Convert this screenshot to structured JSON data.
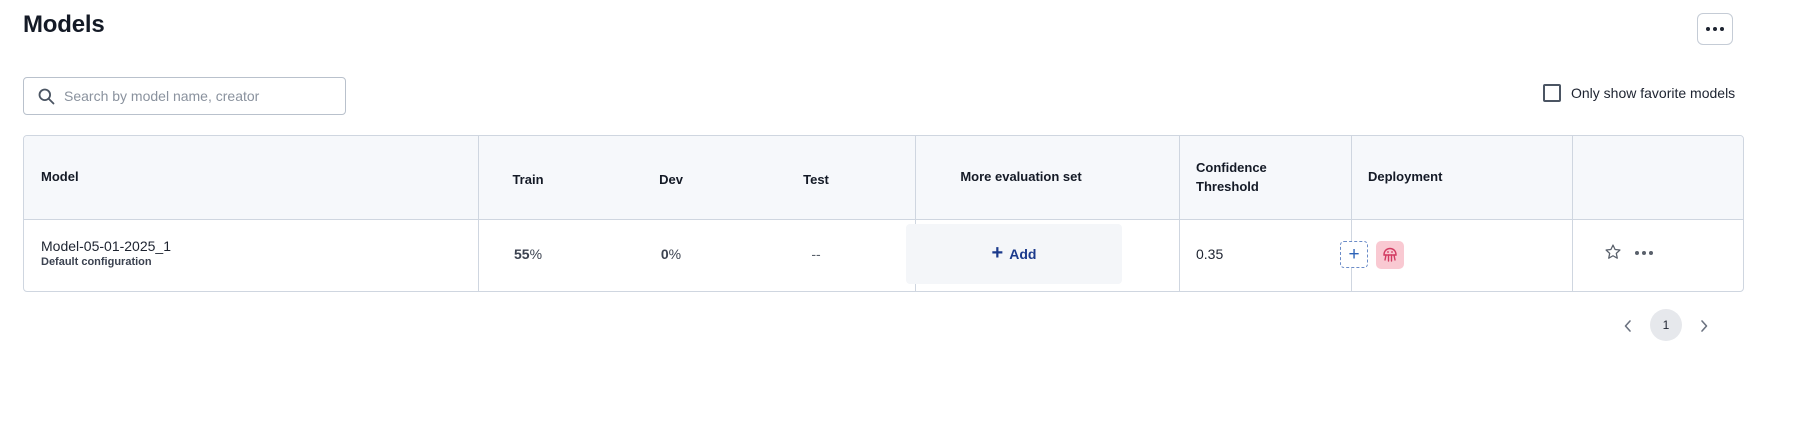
{
  "header": {
    "title": "Models"
  },
  "search": {
    "placeholder": "Search by model name, creator"
  },
  "filters": {
    "favorites_label": "Only show favorite models",
    "favorites_checked": false
  },
  "table": {
    "columns": {
      "model": "Model",
      "train": "Train",
      "dev": "Dev",
      "test": "Test",
      "more_eval": "More evaluation set",
      "confidence_line1": "Confidence",
      "confidence_line2": "Threshold",
      "deployment": "Deployment"
    },
    "rows": [
      {
        "model_name": "Model-05-01-2025_1",
        "configuration": "Default configuration",
        "train_value": "55",
        "train_unit": "%",
        "dev_value": "0",
        "dev_unit": "%",
        "test": "--",
        "add_label": "Add",
        "confidence_threshold": "0.35",
        "favorite": false
      }
    ]
  },
  "pagination": {
    "current_page": "1"
  },
  "icons": {
    "search": "search-icon",
    "more": "more-horizontal-icon",
    "add": "plus-icon",
    "deployment_app": "pink-app-icon",
    "favorite": "star-icon",
    "prev": "chevron-left-icon",
    "next": "chevron-right-icon"
  },
  "colors": {
    "accent": "#1b3a8c",
    "header_bg": "#f6f8fb",
    "border": "#cfd6e0",
    "deploy_app_bg": "#f9c9d2",
    "deploy_app_fg": "#d23b61"
  }
}
